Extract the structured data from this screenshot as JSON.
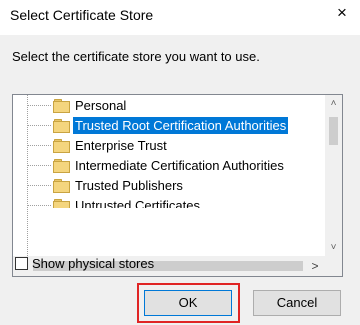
{
  "dialog": {
    "title": "Select Certificate Store",
    "close_label": "×"
  },
  "prompt": "Select the certificate store you want to use.",
  "tree": {
    "items": [
      {
        "label": "Personal",
        "selected": false
      },
      {
        "label": "Trusted Root Certification Authorities",
        "selected": true
      },
      {
        "label": "Enterprise Trust",
        "selected": false
      },
      {
        "label": "Intermediate Certification Authorities",
        "selected": false
      },
      {
        "label": "Trusted Publishers",
        "selected": false
      },
      {
        "label": "Untrusted Certificates",
        "selected": false
      }
    ],
    "scroll_up": "˄",
    "scroll_down": "˅",
    "scroll_left": "<",
    "scroll_right": ">"
  },
  "show_physical_stores": {
    "label": "Show physical stores",
    "checked": false
  },
  "buttons": {
    "ok": "OK",
    "cancel": "Cancel"
  },
  "colors": {
    "selection": "#0078d7",
    "highlight_box": "#e02424"
  }
}
